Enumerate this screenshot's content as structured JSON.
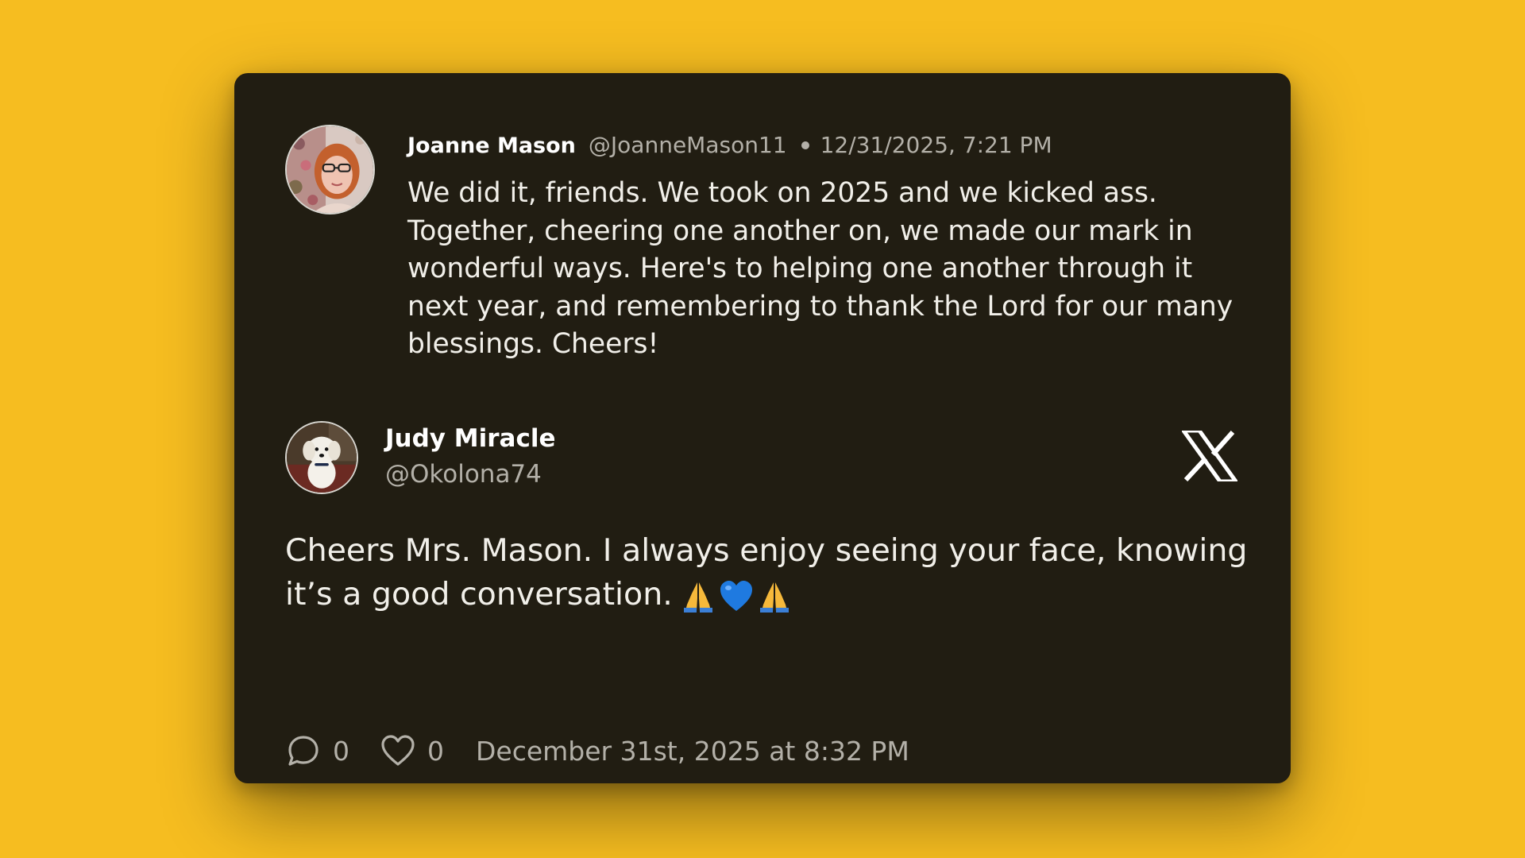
{
  "parent_post": {
    "author_name": "Joanne Mason",
    "author_handle": "@JoanneMason11",
    "timestamp": "12/31/2025, 7:21 PM",
    "text": "We did it, friends. We took on 2025 and we kicked ass. Together, cheering one another on, we made our mark in wonderful ways. Here's to helping one another through it next year, and remembering to thank the Lord for our many blessings. Cheers!"
  },
  "reply_post": {
    "author_name": "Judy Miracle",
    "author_handle": "@Okolona74",
    "text": "Cheers Mrs. Mason. I always enjoy seeing your face, knowing it’s a good conversation.",
    "emojis": [
      "folded-hands",
      "blue-heart",
      "folded-hands"
    ],
    "reply_count": "0",
    "like_count": "0",
    "posted_at": "December 31st, 2025 at 8:32 PM"
  },
  "platform_icon": "x-logo-icon",
  "colors": {
    "background": "#f6bd20",
    "card": "#211d12",
    "primary_text": "#f1efe9",
    "secondary_text": "#b3b0a8"
  }
}
